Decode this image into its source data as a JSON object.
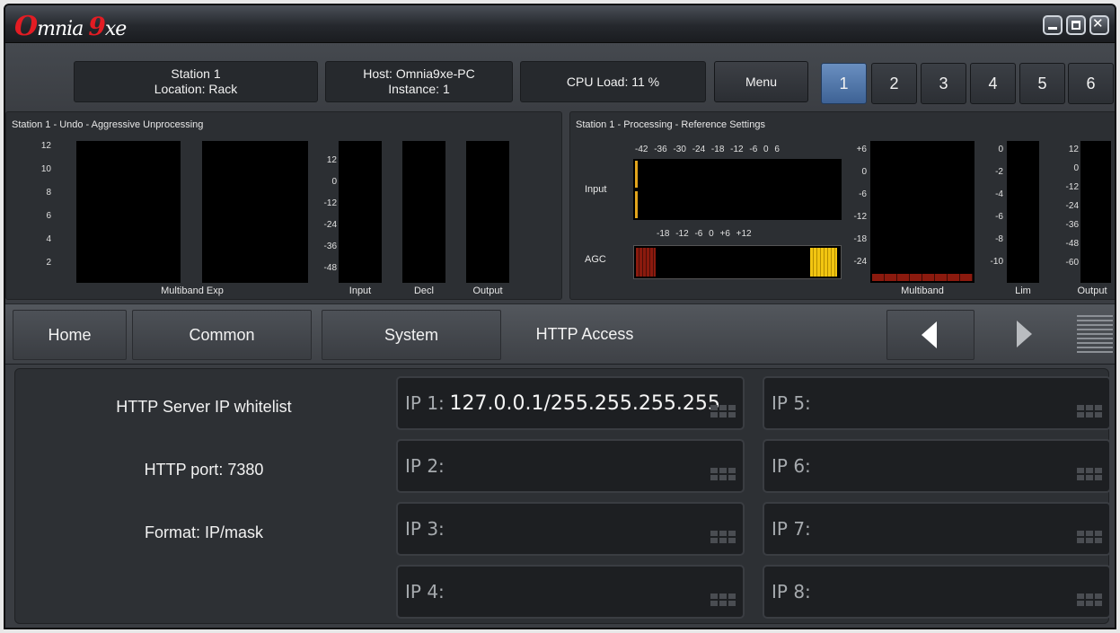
{
  "window": {
    "logo": {
      "o": "O",
      "rest": "mnia",
      "nine": "9",
      "xe": "xe"
    },
    "controls": [
      "minimize",
      "maximize",
      "close"
    ]
  },
  "status": {
    "station_line1": "Station 1",
    "station_line2": "Location: Rack",
    "host_line1": "Host: Omnia9xe-PC",
    "host_line2": "Instance: 1",
    "cpu_load": "CPU Load: 11 %",
    "menu": "Menu",
    "presets": [
      "1",
      "2",
      "3",
      "4",
      "5",
      "6"
    ],
    "active_preset": "1",
    "active_color": "#4f75aa"
  },
  "meters_left": {
    "title": "Station 1 - Undo - Aggressive Unprocessing",
    "scale_exp": [
      "12",
      "10",
      "8",
      "6",
      "4",
      "2"
    ],
    "scale_input": [
      "12",
      "0",
      "-12",
      "-24",
      "-36",
      "-48"
    ],
    "labels": [
      "Multiband Exp",
      "Input",
      "Decl",
      "Output"
    ]
  },
  "meters_right": {
    "title": "Station 1 - Processing - Reference Settings",
    "input_scale": "-42 -36 -30 -24 -18 -12 -6 0 6",
    "agc_scale": "-18 -12 -6 0 +6 +12",
    "input_label": "Input",
    "agc_label": "AGC",
    "mb_scale": [
      "+6",
      "0",
      "-6",
      "-12",
      "-18",
      "-24"
    ],
    "lim_scale": [
      "0",
      "-2",
      "-4",
      "-6",
      "-8",
      "-10"
    ],
    "out_scale": [
      "12",
      "0",
      "-12",
      "-24",
      "-36",
      "-48",
      "-60"
    ],
    "labels": [
      "Multiband",
      "Lim",
      "Output"
    ],
    "agc_level_color": "#f2c511",
    "input_level_color": "#e2a51c",
    "multiband_color": "#8b1a0e"
  },
  "nav": {
    "home": "Home",
    "common": "Common",
    "system": "System",
    "current": "HTTP Access"
  },
  "content": {
    "whitelist_label": "HTTP Server IP whitelist",
    "port_label": "HTTP port: 7380",
    "format_label": "Format: IP/mask",
    "ips": [
      {
        "label": "IP 1:",
        "value": "127.0.0.1/255.255.255.255"
      },
      {
        "label": "IP 2:",
        "value": ""
      },
      {
        "label": "IP 3:",
        "value": ""
      },
      {
        "label": "IP 4:",
        "value": ""
      },
      {
        "label": "IP 5:",
        "value": ""
      },
      {
        "label": "IP 6:",
        "value": ""
      },
      {
        "label": "IP 7:",
        "value": ""
      },
      {
        "label": "IP 8:",
        "value": ""
      }
    ]
  }
}
